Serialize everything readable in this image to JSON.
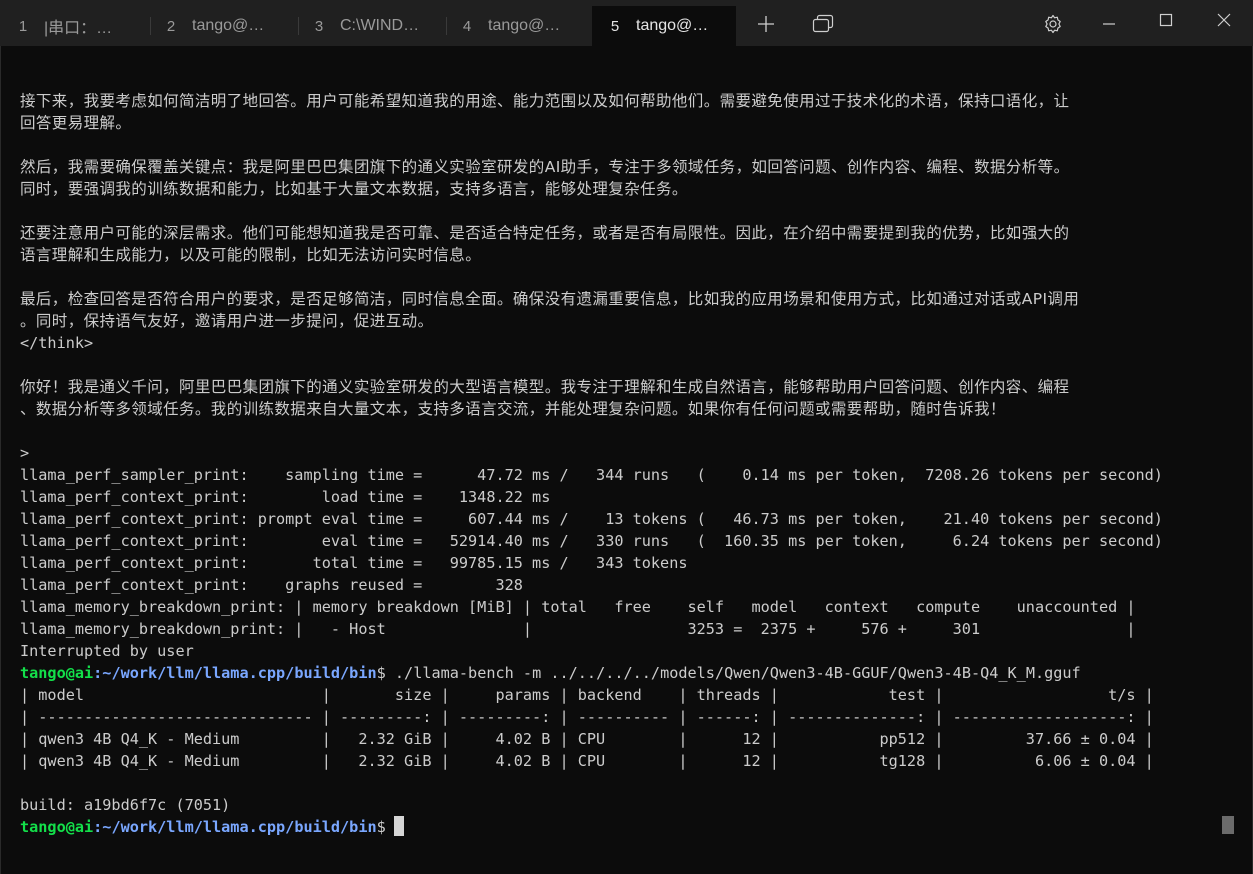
{
  "tabs": [
    {
      "number": "1",
      "label": "|串口：…"
    },
    {
      "number": "2",
      "label": "tango@…"
    },
    {
      "number": "3",
      "label": "C:\\WIND…"
    },
    {
      "number": "4",
      "label": "tango@…"
    },
    {
      "number": "5",
      "label": "tango@…"
    }
  ],
  "toolbar": {
    "new_tab_icon": "plus-icon",
    "tab_switcher_icon": "overlapping-windows-icon",
    "settings_icon": "gear-icon",
    "minimize_icon": "minimize-icon",
    "maximize_icon": "maximize-icon",
    "close_icon": "close-icon"
  },
  "terminal": {
    "lines": [
      "接下来，我要考虑如何简洁明了地回答。用户可能希望知道我的用途、能力范围以及如何帮助他们。需要避免使用过于技术化的术语，保持口语化，让",
      "回答更易理解。",
      "",
      "然后，我需要确保覆盖关键点：我是阿里巴巴集团旗下的通义实验室研发的AI助手，专注于多领域任务，如回答问题、创作内容、编程、数据分析等。",
      "同时，要强调我的训练数据和能力，比如基于大量文本数据，支持多语言，能够处理复杂任务。",
      "",
      "还要注意用户可能的深层需求。他们可能想知道我是否可靠、是否适合特定任务，或者是否有局限性。因此，在介绍中需要提到我的优势，比如强大的",
      "语言理解和生成能力，以及可能的限制，比如无法访问实时信息。",
      "",
      "最后，检查回答是否符合用户的要求，是否足够简洁，同时信息全面。确保没有遗漏重要信息，比如我的应用场景和使用方式，比如通过对话或API调用",
      "。同时，保持语气友好，邀请用户进一步提问，促进互动。",
      "</think>",
      "",
      "你好！我是通义千问，阿里巴巴集团旗下的通义实验室研发的大型语言模型。我专注于理解和生成自然语言，能够帮助用户回答问题、创作内容、编程",
      "、数据分析等多领域任务。我的训练数据来自大量文本，支持多语言交流，并能处理复杂问题。如果你有任何问题或需要帮助，随时告诉我！",
      "",
      ">",
      "llama_perf_sampler_print:    sampling time =      47.72 ms /   344 runs   (    0.14 ms per token,  7208.26 tokens per second)",
      "llama_perf_context_print:        load time =    1348.22 ms",
      "llama_perf_context_print: prompt eval time =     607.44 ms /    13 tokens (   46.73 ms per token,    21.40 tokens per second)",
      "llama_perf_context_print:        eval time =   52914.40 ms /   330 runs   (  160.35 ms per token,     6.24 tokens per second)",
      "llama_perf_context_print:       total time =   99785.15 ms /   343 tokens",
      "llama_perf_context_print:    graphs reused =        328",
      "llama_memory_breakdown_print: | memory breakdown [MiB] | total   free    self   model   context   compute    unaccounted |",
      "llama_memory_breakdown_print: |   - Host               |                 3253 =  2375 +     576 +     301                |",
      "Interrupted by user"
    ],
    "prompt_user": "tango@ai",
    "prompt_path": ":~/work/llm/llama.cpp/build/bin",
    "prompt_symbol": "$",
    "command": " ./llama-bench -m ../../../../models/Qwen/Qwen3-4B-GGUF/Qwen3-4B-Q4_K_M.gguf",
    "bench_lines": [
      "| model                          |       size |     params | backend    | threads |            test |                  t/s |",
      "| ------------------------------ | ---------: | ---------: | ---------- | ------: | --------------: | -------------------: |",
      "| qwen3 4B Q4_K - Medium         |   2.32 GiB |     4.02 B | CPU        |      12 |           pp512 |         37.66 ± 0.04 |",
      "| qwen3 4B Q4_K - Medium         |   2.32 GiB |     4.02 B | CPU        |      12 |           tg128 |          6.06 ± 0.04 |",
      "",
      "build: a19bd6f7c (7051)"
    ]
  },
  "colors": {
    "background": "#0c0c0c",
    "titlebar": "#202020",
    "text": "#cccccc",
    "prompt_user": "#13e04a",
    "prompt_path": "#7aa7ff"
  }
}
